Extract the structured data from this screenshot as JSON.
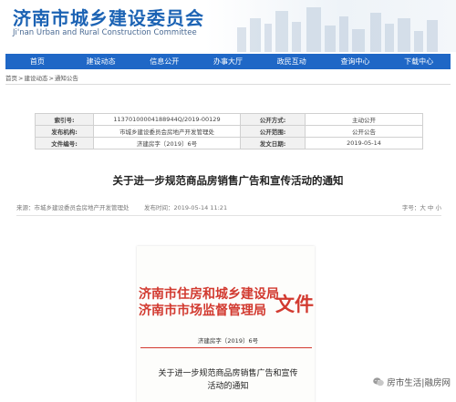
{
  "header": {
    "title": "济南市城乡建设委员会",
    "subtitle": "Ji'nan Urban and Rural Construction Committee"
  },
  "nav": [
    "首页",
    "建设动态",
    "信息公开",
    "办事大厅",
    "政民互动",
    "查询中心",
    "下载中心"
  ],
  "breadcrumb": [
    "首页",
    ">",
    "建设动态",
    ">",
    "通知公告"
  ],
  "meta": {
    "rows": [
      {
        "k1": "索引号:",
        "v1": "11370100004188944Q/2019-00129",
        "k2": "公开方式:",
        "v2": "主动公开"
      },
      {
        "k1": "发布机构:",
        "v1": "市城乡建设委员会房地产开发管理处",
        "k2": "公开范围:",
        "v2": "公开公告"
      },
      {
        "k1": "文件编号:",
        "v1": "济建房字〔2019〕6号",
        "k2": "发文日期:",
        "v2": "2019-05-14"
      }
    ]
  },
  "article": {
    "title": "关于进一步规范商品房销售广告和宣传活动的通知",
    "source": "来源：市城乡建设委员会房地产开发管理处",
    "publish_time": "发布时间：2019-05-14 11:21",
    "font_size": "字号：大 中 小"
  },
  "document": {
    "issuer_line1": "济南市住房和城乡建设局",
    "issuer_line2": "济南市市场监督管理局",
    "file_char": "文件",
    "doc_number": "济建房字〔2019〕6号",
    "notice_line1": "关于进一步规范商品房销售广告和宣传",
    "notice_line2": "活动的通知"
  },
  "watermark": {
    "text": "房市生活|融房网",
    "icon": "wechat-icon"
  },
  "colors": {
    "brand_blue": "#1c63b4",
    "nav_blue": "#1f67c6",
    "seal_red": "#d23a30"
  }
}
